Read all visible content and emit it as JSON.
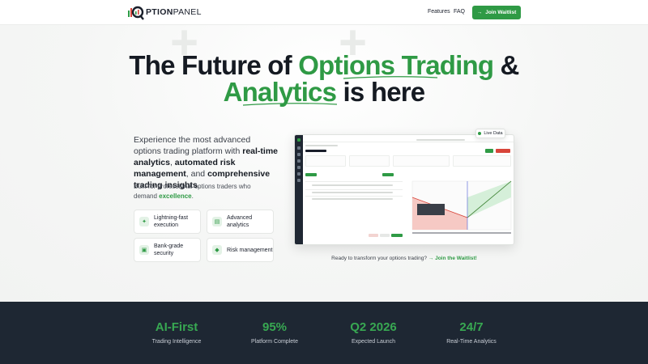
{
  "brand": {
    "logo_text_strong": "PTION",
    "logo_text_light": "PANEL",
    "accent": "#2f9a45",
    "dark": "#1e2733"
  },
  "nav": {
    "features": "Features",
    "faq": "FAQ",
    "cta": "Join Waitlist",
    "cta_icon": "arrow-right-icon"
  },
  "hero": {
    "title_line1_a": "The Future of ",
    "title_line1_b": "Options Trading",
    "title_line1_c": " &",
    "title_line2_a": "Analytics",
    "title_line2_b": " is here",
    "lead_1": "Experience the most advanced options trading platform with ",
    "lead_b1": "real-time analytics",
    "lead_2": ", ",
    "lead_b2": "automated risk management",
    "lead_3": ", and ",
    "lead_b3": "comprehensive trading insights",
    "lead_4": ".",
    "sub_1": "Built for professional options traders who demand ",
    "sub_b": "excellence",
    "sub_2": "."
  },
  "features": [
    {
      "icon": "lightning-icon",
      "label": "Lightning-fast execution"
    },
    {
      "icon": "chart-icon",
      "label": "Advanced analytics"
    },
    {
      "icon": "lock-icon",
      "label": "Bank-grade security"
    },
    {
      "icon": "shield-icon",
      "label": "Risk management"
    }
  ],
  "preview": {
    "live_badge": "Live Data",
    "cta_text": "Ready to transform your options trading?",
    "cta_link": "Join the Waitlist!"
  },
  "stats": [
    {
      "value": "AI-First",
      "label": "Trading Intelligence"
    },
    {
      "value": "95%",
      "label": "Platform Complete"
    },
    {
      "value": "Q2 2026",
      "label": "Expected Launch"
    },
    {
      "value": "24/7",
      "label": "Real-Time Analytics"
    }
  ]
}
